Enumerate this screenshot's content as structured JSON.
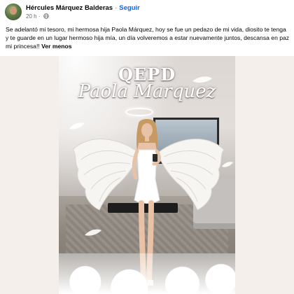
{
  "post": {
    "author": "Hércules Márquez Balderas",
    "separator": "·",
    "follow_label": "Seguir",
    "timestamp": "20 h",
    "meta_separator": "·",
    "audience_icon": "globe-icon",
    "text": "Se adelantó mi tesoro, mi hermosa hija Paola Márquez, hoy se fue un pedazo de mi vida, diosito te tenga y te guarde en un lugar hermoso hija mía, un día volveremos a estar nuevamente juntos, descansa en paz mi princesa!! ",
    "see_less_label": "Ver menos"
  },
  "image": {
    "heading": "QEPD",
    "name": "Paola Marquez"
  },
  "colors": {
    "link": "#0866ff",
    "text": "#050505",
    "muted": "#65676b",
    "media_bg": "#f3ede9"
  }
}
